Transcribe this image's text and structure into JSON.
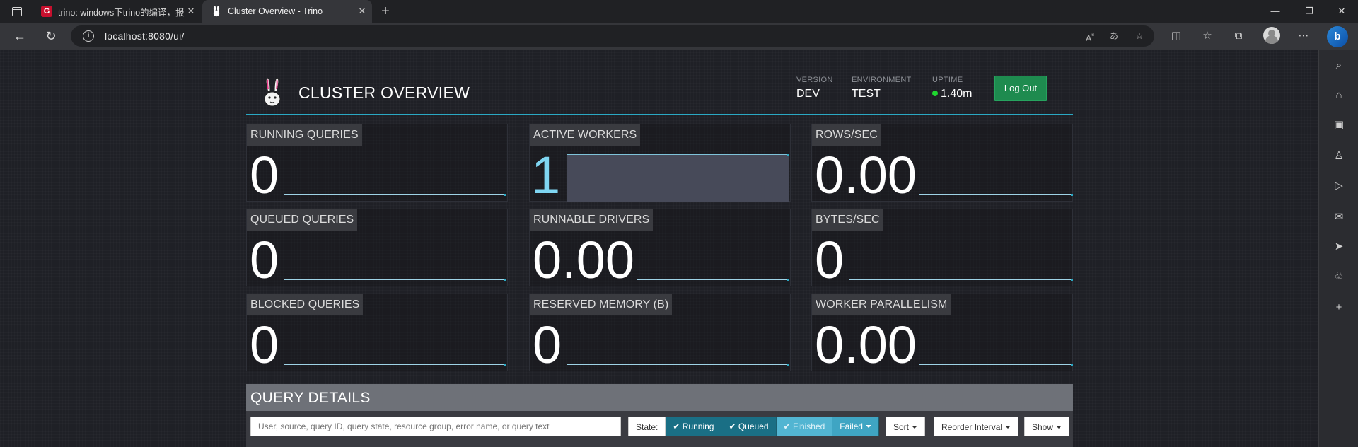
{
  "browser": {
    "tabs": [
      {
        "title": "trino: windows下trino的编译，报",
        "favicon": "G"
      },
      {
        "title": "Cluster Overview - Trino",
        "favicon": "trino-bunny"
      }
    ],
    "url": "localhost:8080/ui/"
  },
  "header": {
    "title": "CLUSTER OVERVIEW",
    "version_label": "VERSION",
    "version_value": "DEV",
    "environment_label": "ENVIRONMENT",
    "environment_value": "TEST",
    "uptime_label": "UPTIME",
    "uptime_value": "1.40m",
    "logout_label": "Log Out"
  },
  "metrics": [
    {
      "label": "RUNNING QUERIES",
      "value": "0"
    },
    {
      "label": "ACTIVE WORKERS",
      "value": "1"
    },
    {
      "label": "ROWS/SEC",
      "value": "0.00"
    },
    {
      "label": "QUEUED QUERIES",
      "value": "0"
    },
    {
      "label": "RUNNABLE DRIVERS",
      "value": "0.00"
    },
    {
      "label": "BYTES/SEC",
      "value": "0"
    },
    {
      "label": "BLOCKED QUERIES",
      "value": "0"
    },
    {
      "label": "RESERVED MEMORY (B)",
      "value": "0"
    },
    {
      "label": "WORKER PARALLELISM",
      "value": "0.00"
    }
  ],
  "query_details": {
    "title": "QUERY DETAILS",
    "search_placeholder": "User, source, query ID, query state, resource group, error name, or query text",
    "state_label": "State:",
    "state_filters": [
      {
        "label": "Running",
        "active": true
      },
      {
        "label": "Queued",
        "active": true
      },
      {
        "label": "Finished",
        "active": false
      },
      {
        "label": "Failed",
        "active": true
      }
    ],
    "sort_label": "Sort",
    "reorder_label": "Reorder Interval",
    "show_label": "Show"
  },
  "colors": {
    "accent": "#2aa8c3",
    "logout_green": "#1e8b4f",
    "uptime_dot": "#1fd62f"
  }
}
